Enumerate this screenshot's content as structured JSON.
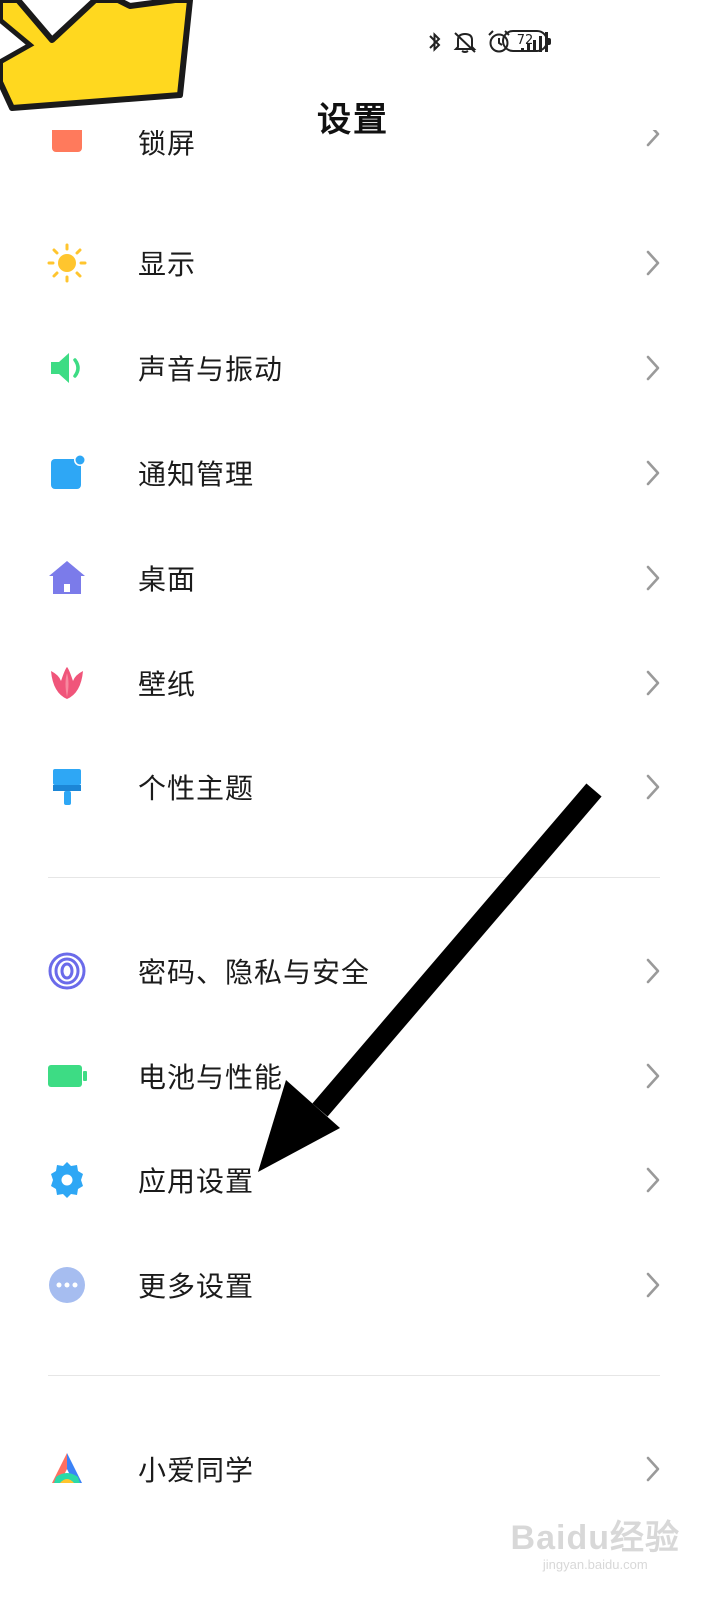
{
  "status_bar": {
    "icons": [
      "bluetooth-icon",
      "mute-icon",
      "alarm-icon",
      "signal-icon"
    ],
    "battery_level": "72"
  },
  "header": {
    "title": "设置"
  },
  "partial_item": {
    "label": "锁屏"
  },
  "items": [
    {
      "label": "显示",
      "icon": "sun-icon",
      "color": "#FFC52E"
    },
    {
      "label": "声音与振动",
      "icon": "speaker-icon",
      "color": "#3DDC84"
    },
    {
      "label": "通知管理",
      "icon": "notification-icon",
      "color": "#2EA7F5"
    },
    {
      "label": "桌面",
      "icon": "home-icon",
      "color": "#7B7BEA"
    },
    {
      "label": "壁纸",
      "icon": "tulip-icon",
      "color": "#F0557A"
    },
    {
      "label": "个性主题",
      "icon": "brush-icon",
      "color": "#2EA7F5"
    },
    {
      "label": "密码、隐私与安全",
      "icon": "fingerprint-icon",
      "color": "#6B6BEA"
    },
    {
      "label": "电池与性能",
      "icon": "battery-icon",
      "color": "#3DDC84"
    },
    {
      "label": "应用设置",
      "icon": "gear-icon",
      "color": "#2EA7F5"
    },
    {
      "label": "更多设置",
      "icon": "more-icon",
      "color": "#A6BDF0"
    },
    {
      "label": "小爱同学",
      "icon": "xiaoai-icon",
      "color": "#FF6F61"
    }
  ],
  "watermark": {
    "main": "Baidu经验",
    "sub": "jingyan.baidu.com"
  }
}
